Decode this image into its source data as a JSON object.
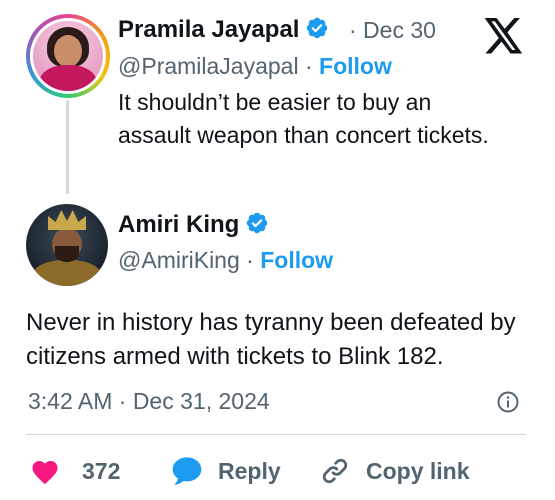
{
  "parent_tweet": {
    "author_name": "Pramila Jayapal",
    "separator_date": "· Dec 30",
    "handle": "@PramilaJayapal",
    "handle_separator": " · ",
    "follow_label": "Follow",
    "text": "It shouldn’t be easier to buy an assault weapon than concert tickets."
  },
  "main_tweet": {
    "author_name": "Amiri King",
    "handle": "@AmiriKing",
    "handle_separator": " · ",
    "follow_label": "Follow",
    "text": "Never in history has tyranny been defeated by citizens armed with tickets to Blink 182.",
    "timestamp": "3:42 AM · Dec 31, 2024"
  },
  "actions": {
    "like_count": "372",
    "reply_label": "Reply",
    "copy_link_label": "Copy link"
  },
  "colors": {
    "accent": "#1d9bf0",
    "like": "#f91880",
    "secondary_text": "#536471",
    "divider": "#cfd9de"
  },
  "icons": {
    "verified": "verified-badge-icon",
    "brand": "x-logo-icon",
    "info": "info-icon",
    "like": "heart-icon",
    "reply": "speech-bubble-icon",
    "copy_link": "link-icon"
  }
}
